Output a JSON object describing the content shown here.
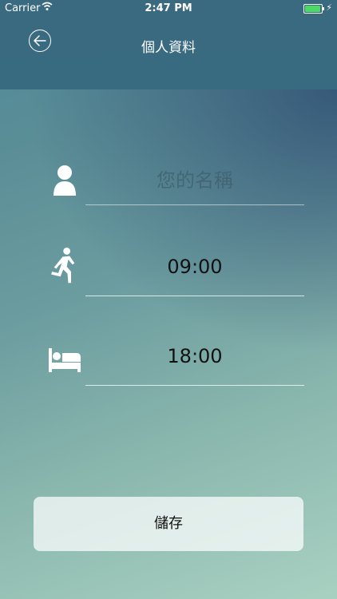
{
  "status_bar": {
    "carrier": "Carrier",
    "time": "2:47 PM",
    "battery_color": "#4cd964"
  },
  "nav": {
    "title": "個人資料",
    "back_icon": "arrow-left-circle-icon"
  },
  "form": {
    "name_placeholder": "您的名稱",
    "wake_time": "09:00",
    "sleep_time": "18:00",
    "icons": [
      "person-icon",
      "running-person-icon",
      "bed-icon"
    ]
  },
  "actions": {
    "save_label": "儲存"
  }
}
